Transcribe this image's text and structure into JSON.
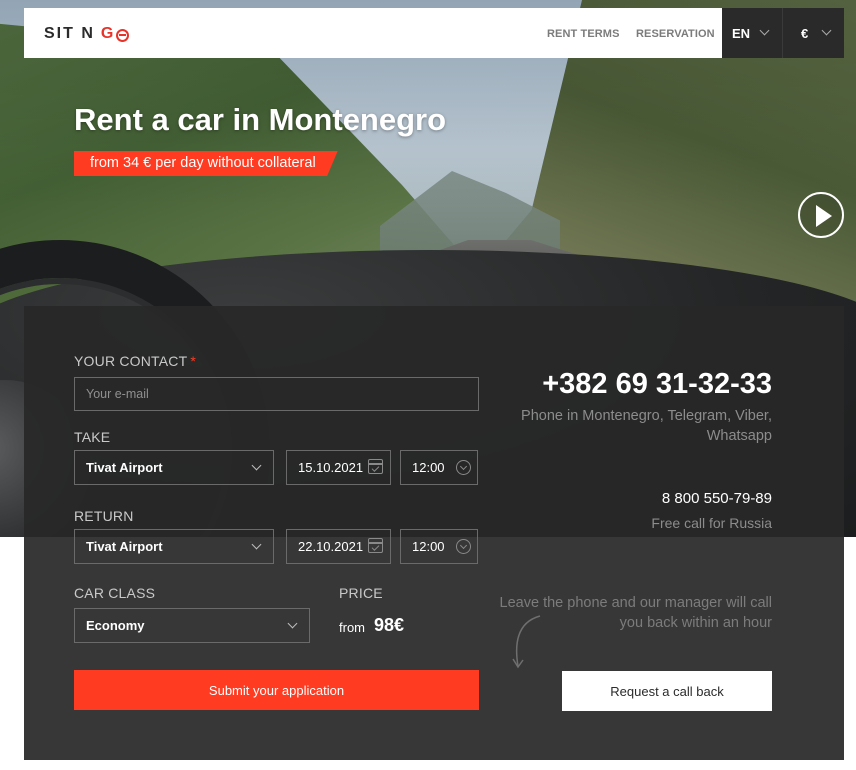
{
  "brand": {
    "logo_text": "SIT N ",
    "logo_accent": "GO",
    "accent_color": "#ff3b22"
  },
  "nav": {
    "rent_terms": "RENT TERMS",
    "reservation": "RESERVATION",
    "language": "EN",
    "currency": "€"
  },
  "hero": {
    "title": "Rent a car in Montenegro",
    "badge": "from 34 € per day without collateral"
  },
  "form": {
    "contact_label": "YOUR CONTACT",
    "contact_required_mark": "*",
    "email_placeholder": "Your e-mail",
    "take_label": "TAKE",
    "take_location": "Tivat Airport",
    "take_date": "15.10.2021",
    "take_time": "12:00",
    "return_label": "RETURN",
    "return_location": "Tivat Airport",
    "return_date": "22.10.2021",
    "return_time": "12:00",
    "car_class_label": "CAR CLASS",
    "car_class_value": "Economy",
    "price_label": "PRICE",
    "price_from": "from",
    "price_value": "98€",
    "submit_label": "Submit your application"
  },
  "contact": {
    "phone_main": "+382 69 31-32-33",
    "phone_main_note": "Phone in Montenegro, Telegram, Viber, Whatsapp",
    "phone_ru": "8 800 550-79-89",
    "phone_ru_note": "Free call for Russia",
    "callback_note": "Leave the phone and our manager will call you back within an hour",
    "callback_label": "Request a call back"
  }
}
